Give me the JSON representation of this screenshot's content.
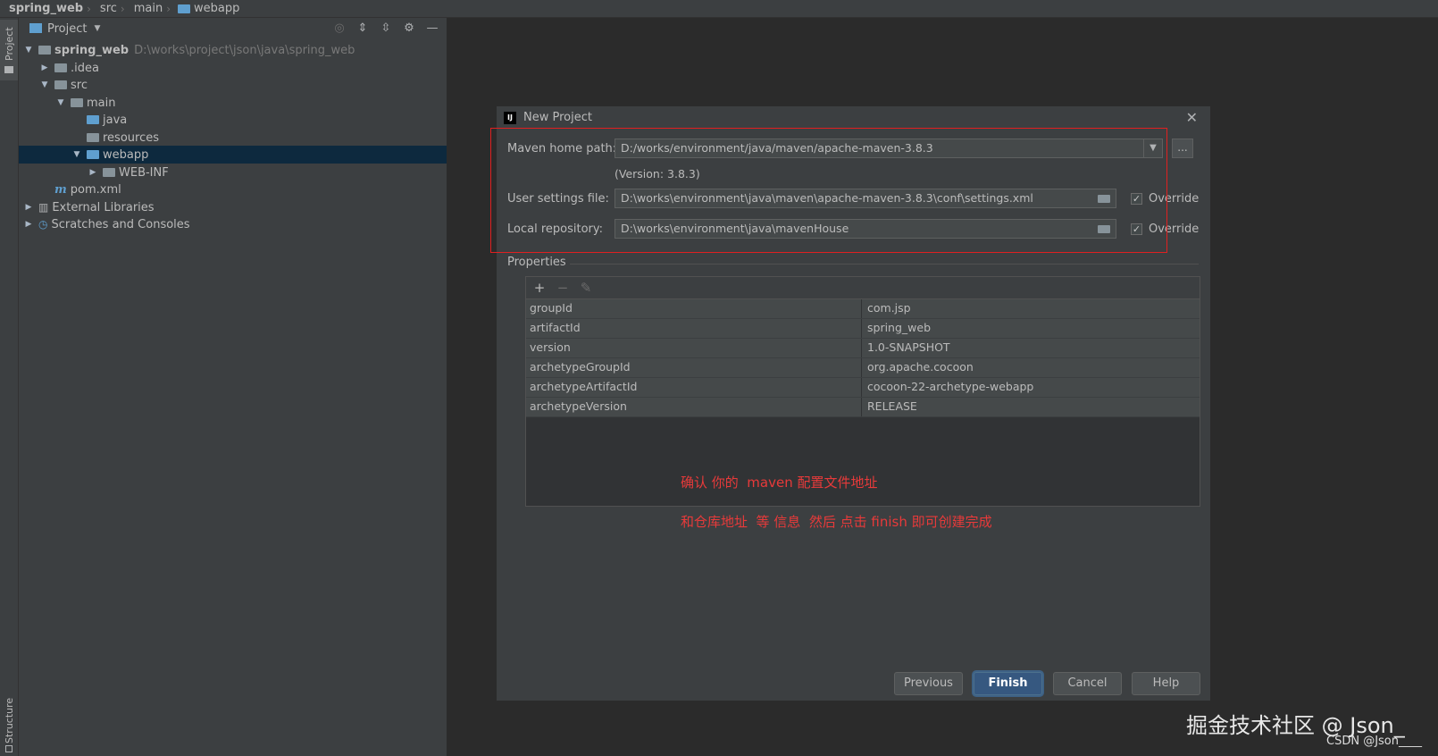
{
  "breadcrumb": [
    {
      "label": "spring_web"
    },
    {
      "label": "src"
    },
    {
      "label": "main"
    },
    {
      "label": "webapp"
    }
  ],
  "side_tabs": {
    "project": "Project",
    "structure": "Structure"
  },
  "panel": {
    "title": "Project",
    "tree": [
      {
        "label": "spring_web",
        "path": "D:\\works\\project\\json\\java\\spring_web"
      },
      {
        "label": ".idea"
      },
      {
        "label": "src"
      },
      {
        "label": "main"
      },
      {
        "label": "java"
      },
      {
        "label": "resources"
      },
      {
        "label": "webapp"
      },
      {
        "label": "WEB-INF"
      },
      {
        "label": "pom.xml"
      },
      {
        "label": "External Libraries"
      },
      {
        "label": "Scratches and Consoles"
      }
    ]
  },
  "dialog": {
    "title": "New Project",
    "maven_home_label": "Maven home path:",
    "maven_home_value": "D:/works/environment/java/maven/apache-maven-3.8.3",
    "maven_version": "(Version: 3.8.3)",
    "browse_label": "...",
    "settings_label": "User settings file:",
    "settings_value": "D:\\works\\environment\\java\\maven\\apache-maven-3.8.3\\conf\\settings.xml",
    "settings_override": "Override",
    "repo_label": "Local repository:",
    "repo_value": "D:\\works\\environment\\java\\mavenHouse",
    "repo_override": "Override",
    "properties_label": "Properties",
    "properties": [
      {
        "key": "groupId",
        "value": "com.jsp"
      },
      {
        "key": "artifactId",
        "value": "spring_web"
      },
      {
        "key": "version",
        "value": "1.0-SNAPSHOT"
      },
      {
        "key": "archetypeGroupId",
        "value": "org.apache.cocoon"
      },
      {
        "key": "archetypeArtifactId",
        "value": "cocoon-22-archetype-webapp"
      },
      {
        "key": "archetypeVersion",
        "value": "RELEASE"
      }
    ],
    "note_line1": "确认 你的  maven 配置文件地址",
    "note_line2": "和仓库地址  等 信息  然后 点击 finish 即可创建完成",
    "buttons": {
      "previous": "Previous",
      "finish": "Finish",
      "cancel": "Cancel",
      "help": "Help"
    }
  },
  "watermark": {
    "main": "掘金技术社区 @ Json_",
    "sub": "CSDN @Json____"
  }
}
